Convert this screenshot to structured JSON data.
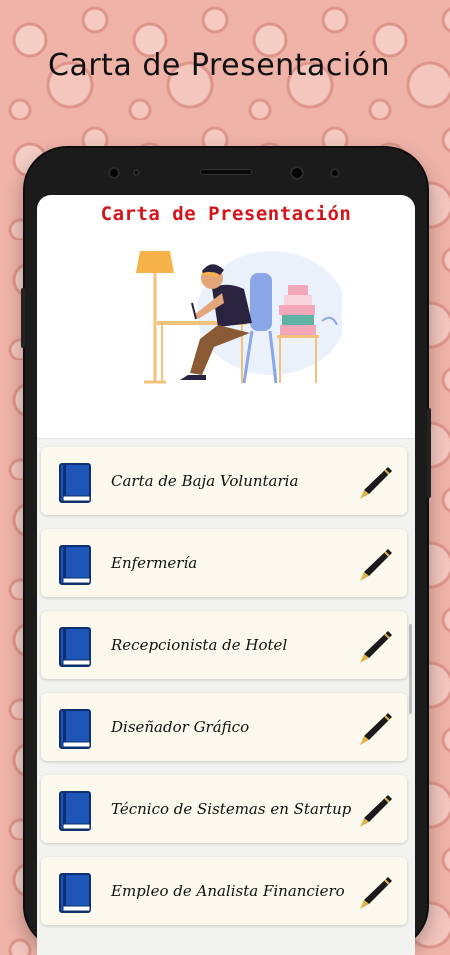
{
  "store": {
    "title": "Carta de Presentación"
  },
  "app": {
    "title": "Carta de Presentación",
    "accent_color": "#d4141c"
  },
  "hero": {
    "illustration": "person-writing-at-desk-illustration"
  },
  "list": {
    "items": [
      {
        "label": "Carta de Baja Voluntaria",
        "icon": "book-icon",
        "action_icon": "pen-icon"
      },
      {
        "label": "Enfermería",
        "icon": "book-icon",
        "action_icon": "pen-icon"
      },
      {
        "label": "Recepcionista de Hotel",
        "icon": "book-icon",
        "action_icon": "pen-icon"
      },
      {
        "label": "Diseñador Gráfico",
        "icon": "book-icon",
        "action_icon": "pen-icon"
      },
      {
        "label": "Técnico de Sistemas en Startup",
        "icon": "book-icon",
        "action_icon": "pen-icon"
      },
      {
        "label": "Empleo de Analista Financiero",
        "icon": "book-icon",
        "action_icon": "pen-icon"
      }
    ]
  }
}
